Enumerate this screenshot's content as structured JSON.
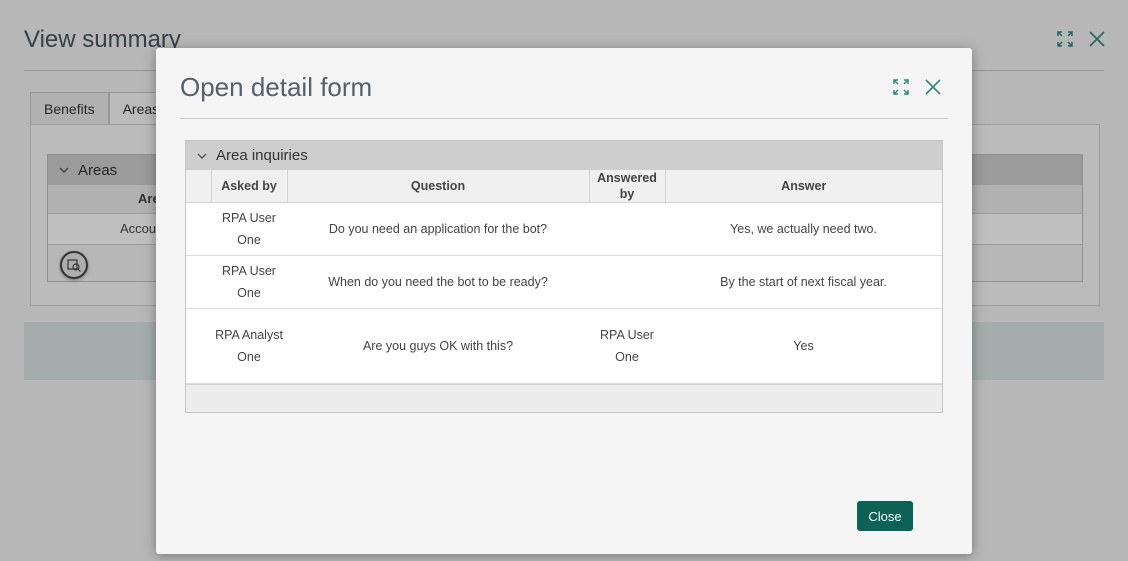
{
  "background": {
    "title": "View summary",
    "tabs": [
      {
        "label": "Benefits"
      },
      {
        "label": "Areas"
      }
    ],
    "grid": {
      "caption": "Areas",
      "column_header": "Are",
      "row_value": "Accour"
    }
  },
  "modal": {
    "title": "Open detail form",
    "grid": {
      "caption": "Area inquiries",
      "columns": {
        "asked_by": "Asked by",
        "question": "Question",
        "answered_by": "Answered by",
        "answer": "Answer"
      },
      "rows": [
        {
          "asked_by": "RPA User One",
          "question": "Do you need an application for the bot?",
          "answered_by": "",
          "answer": "Yes, we actually need two."
        },
        {
          "asked_by": "RPA User One",
          "question": "When do you need the bot to be ready?",
          "answered_by": "",
          "answer": "By the start of next fiscal year."
        },
        {
          "asked_by": "RPA Analyst One",
          "question": "Are you guys OK with this?",
          "answered_by": "RPA User One",
          "answer": "Yes"
        }
      ]
    },
    "close_label": "Close"
  },
  "icons": {
    "expand": "expand-icon",
    "close": "close-icon",
    "collapse": "chevron-down-icon",
    "view_detail": "view-detail-icon"
  },
  "colors": {
    "primary": "#0b6255",
    "icon_teal": "#2f8a78"
  }
}
